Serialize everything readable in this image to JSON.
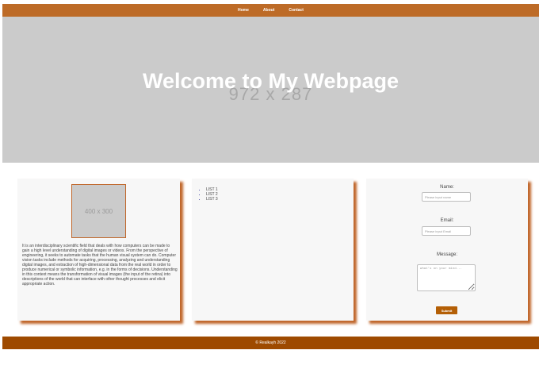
{
  "nav": {
    "items": [
      {
        "label": "Home"
      },
      {
        "label": "About"
      },
      {
        "label": "Contact"
      }
    ]
  },
  "hero": {
    "placeholder": "972 x 287",
    "title": "Welcome to My Webpage"
  },
  "card1": {
    "image_placeholder": "400 x 300",
    "text": "It is an interdisciplinary scientific field that deals with how computers can be made to gain a high level understanding of digital images or videos. From the perspective of engineering, it seeks to automate tasks that the human visual system can do. Computer vision tasks include methods for acquiring, processing, analyzing and understanding digital images, and extraction of high-dimensional data from the real world in order to produce numerical or symbolic information, e.g. in the forms of decisions. Understanding in this context means the transformation of visual images (the input of the retina) into descriptions of the world that can interface with other thought processes and elicit appropriate action."
  },
  "card2": {
    "list": [
      "LIST 1",
      "LIST 2",
      "LIST 3"
    ]
  },
  "form": {
    "name_label": "Name:",
    "name_placeholder": "Please input name",
    "name_value": "",
    "email_label": "Email:",
    "email_placeholder": "Please input Email",
    "email_value": "",
    "message_label": "Message:",
    "message_placeholder": "what's on your mind...",
    "message_value": "",
    "submit_label": "Submit"
  },
  "footer": {
    "text": "© Realkayh 2022"
  },
  "colors": {
    "accent": "#bd6b27",
    "footer": "#9e4a00",
    "button": "#b45f06",
    "hero_bg": "#cbcbcb"
  }
}
